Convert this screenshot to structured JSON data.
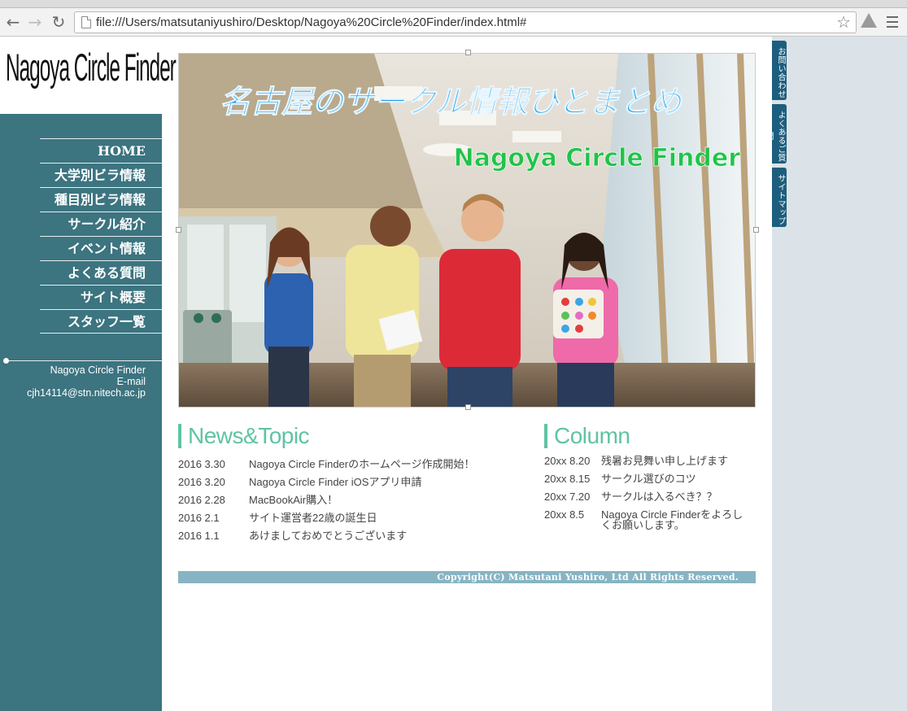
{
  "browser": {
    "url": "file:///Users/matsutaniyushiro/Desktop/Nagoya%20Circle%20Finder/index.html#"
  },
  "site": {
    "logo": "Nagoya Circle Finder",
    "menu": [
      {
        "label": "HOME"
      },
      {
        "label": "大学別ビラ情報"
      },
      {
        "label": "種目別ビラ情報"
      },
      {
        "label": "サークル紹介"
      },
      {
        "label": "イベント情報"
      },
      {
        "label": "よくある質問"
      },
      {
        "label": "サイト概要"
      },
      {
        "label": "スタッフ一覧"
      }
    ],
    "contact": {
      "name": "Nagoya Circle Finder",
      "email_label": "E-mail",
      "email": "cjh14114@stn.nitech.ac.jp"
    }
  },
  "hero": {
    "headline_jp": "名古屋のサークル情報ひとまとめ",
    "headline_en": "Nagoya Circle Finder"
  },
  "news": {
    "title": "News&Topic",
    "items": [
      {
        "date": "2016 3.30",
        "text": "Nagoya Circle Finderのホームページ作成開始！"
      },
      {
        "date": "2016 3.20",
        "text": "Nagoya Circle Finder iOSアプリ申請"
      },
      {
        "date": "2016 2.28",
        "text": "MacBookAir購入！"
      },
      {
        "date": "2016 2.1",
        "text": "サイト運営者22歳の誕生日"
      },
      {
        "date": "2016 1.1",
        "text": "あけましておめでとうございます"
      }
    ]
  },
  "column": {
    "title": "Column",
    "items": [
      {
        "date": "20xx 8.20",
        "text": "残暑お見舞い申し上げます"
      },
      {
        "date": "20xx 8.15",
        "text": "サークル選びのコツ"
      },
      {
        "date": "20xx 7.20",
        "text": "サークルは入るべき？？"
      },
      {
        "date": "20xx 8.5",
        "text": "Nagoya Circle Finderをよろしくお願いします。"
      }
    ]
  },
  "footer": {
    "copyright": "Copyright(C) Matsutani Yushiro, Ltd All Rights Reserved."
  },
  "side_tabs": [
    {
      "label": "お問い合わせ"
    },
    {
      "label": "よくあるご質問"
    },
    {
      "label": "サイトマップ"
    }
  ],
  "colors": {
    "sidebar": "#3c7480",
    "accent_green": "#5fc3a4",
    "headline_blue": "#1fa3e8",
    "headline_green": "#22c24a",
    "footer_bar": "#87b4c3",
    "side_tab": "#1d5e7e"
  },
  "icons": [
    "back-arrow-icon",
    "forward-arrow-icon",
    "reload-icon",
    "page-icon",
    "star-icon",
    "drive-icon",
    "menu-icon"
  ]
}
